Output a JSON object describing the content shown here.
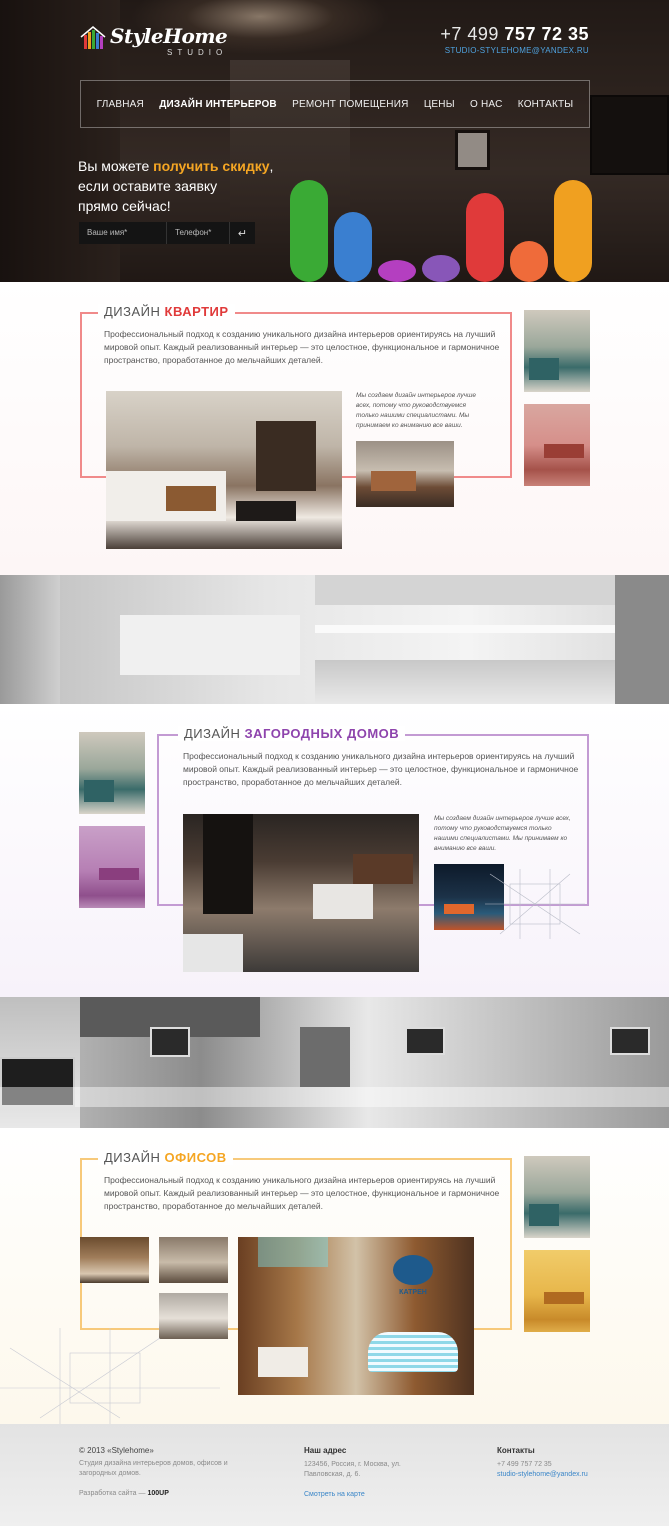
{
  "colors": {
    "red": "#e03a3a",
    "purple": "#8e44ad",
    "orange": "#f5a623",
    "green": "#3aaa35",
    "blue": "#3a7fd0",
    "magenta": "#b43fc0",
    "violet": "#8856b8",
    "coral": "#ef6b3a",
    "amber": "#f0a020",
    "frame_red": "#f08a8a",
    "frame_purple": "#c39bd3",
    "frame_orange": "#f7c97a",
    "link": "#3a86c8"
  },
  "header": {
    "logo_name": "StyleHome",
    "logo_sub": "STUDIO",
    "phone_code": "+7 499",
    "phone_number": "757 72 35",
    "email": "STUDIO-STYLEHOME@YANDEX.RU"
  },
  "nav": {
    "items": [
      {
        "label": "ГЛАВНАЯ"
      },
      {
        "label": "ДИЗАЙН ИНТЕРЬЕРОВ"
      },
      {
        "label": "РЕМОНТ ПОМЕЩЕНИЯ"
      },
      {
        "label": "ЦЕНЫ"
      },
      {
        "label": "О НАС"
      },
      {
        "label": "КОНТАКТЫ"
      }
    ]
  },
  "promo": {
    "line1_pre": "Вы можете ",
    "line1_hl": "получить скидку",
    "line1_post": ",",
    "line2": "если оставите заявку",
    "line3": "прямо сейчас!",
    "name_placeholder": "Ваше имя*",
    "phone_placeholder": "Телефон*",
    "submit_icon": "enter-arrow-icon"
  },
  "sections": [
    {
      "title_pre": "ДИЗАЙН ",
      "title_hl": "КВАРТИР",
      "description": "Профессиональный подход к созданию уникального дизайна интерьеров ориентируясь на лучший мировой опыт. Каждый реализованный интерьер — это целостное, функциональное и гармоничное пространство, проработанное до мельчайших деталей.",
      "note": "Мы создаем дизайн интерьеров лучше всех, потому что руководствуемся только нашими специалистами. Мы принимаем ко вниманию все ваши."
    },
    {
      "title_pre": "ДИЗАЙН ",
      "title_hl": "ЗАГОРОДНЫХ ДОМОВ",
      "description": "Профессиональный подход к созданию уникального дизайна интерьеров ориентируясь на лучший мировой опыт. Каждый реализованный интерьер — это целостное, функциональное и гармоничное пространство, проработанное до мельчайших деталей.",
      "note": "Мы создаем дизайн интерьеров лучше всех, потому что руководствуемся только нашими специалистами. Мы принимаем ко вниманию все ваши."
    },
    {
      "title_pre": "ДИЗАЙН ",
      "title_hl": "ОФИСОВ",
      "description": "Профессиональный подход к созданию уникального дизайна интерьеров ориентируясь на лучший мировой опыт. Каждый реализованный интерьер — это целостное, функциональное и гармоничное пространство, проработанное до мельчайших деталей.",
      "reception_sign": "КАТРЕН"
    }
  ],
  "footer": {
    "copyright": "© 2013 «Stylehome»",
    "tagline": "Студия дизайна интерьеров домов, офисов и загородных домов.",
    "dev_label": "Разработка сайта — ",
    "dev_name": "100UP",
    "address_title": "Наш адрес",
    "address": "123456, Россия, г. Москва, ул. Павловская, д. 6.",
    "map_link": "Смотреть на карте",
    "contacts_title": "Контакты",
    "contact_phone": "+7 499 757 72 35",
    "contact_email": "studio-stylehome@yandex.ru"
  }
}
